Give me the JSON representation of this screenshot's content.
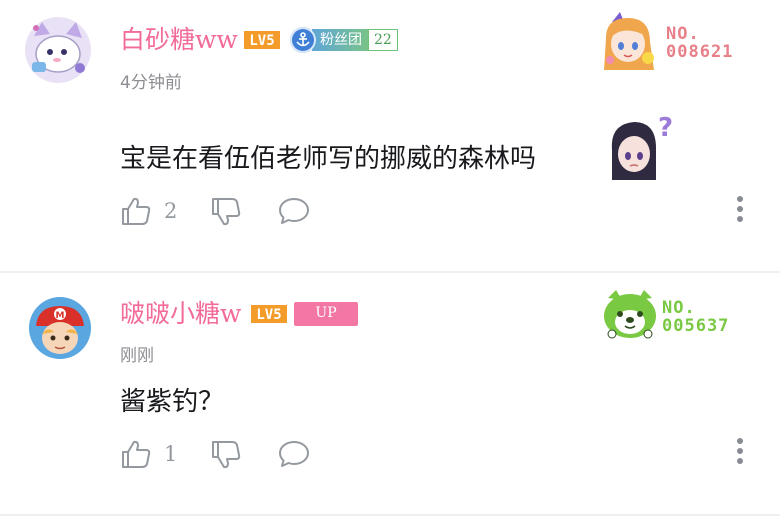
{
  "comments": [
    {
      "username": "白砂糖ww",
      "level_badge": "LV5",
      "fan_badge": {
        "name": "粉丝团",
        "level": "22",
        "icon": "anchor-icon"
      },
      "time": "4分钟前",
      "content": "宝是在看伍佰老师写的挪威的森林吗",
      "inline_sticker": "confused-anime-girl-sticker",
      "likes": "2",
      "nameplate": {
        "label": "NO.",
        "number": "008621",
        "color": "#e8808a",
        "art": "anime-girl-nameplate"
      },
      "avatar": "white-cat-mascot-avatar"
    },
    {
      "username": "啵啵小糖w",
      "level_badge": "LV5",
      "up_badge": "UP",
      "time": "刚刚",
      "content": "酱紫钓？",
      "likes": "1",
      "nameplate": {
        "label": "NO.",
        "number": "005637",
        "color": "#7ac943",
        "art": "green-shiba-dog-nameplate"
      },
      "avatar": "mario-cap-character-avatar"
    }
  ],
  "actions": {
    "like_icon": "thumbs-up-icon",
    "dislike_icon": "thumbs-down-icon",
    "reply_icon": "chat-bubble-icon",
    "more_icon": "vertical-dots-icon"
  },
  "colors": {
    "username": "#f26b9a",
    "level_badge": "#f39c2a",
    "up_badge": "#f277a4",
    "text": "#18191c",
    "muted": "#8d8d93"
  }
}
